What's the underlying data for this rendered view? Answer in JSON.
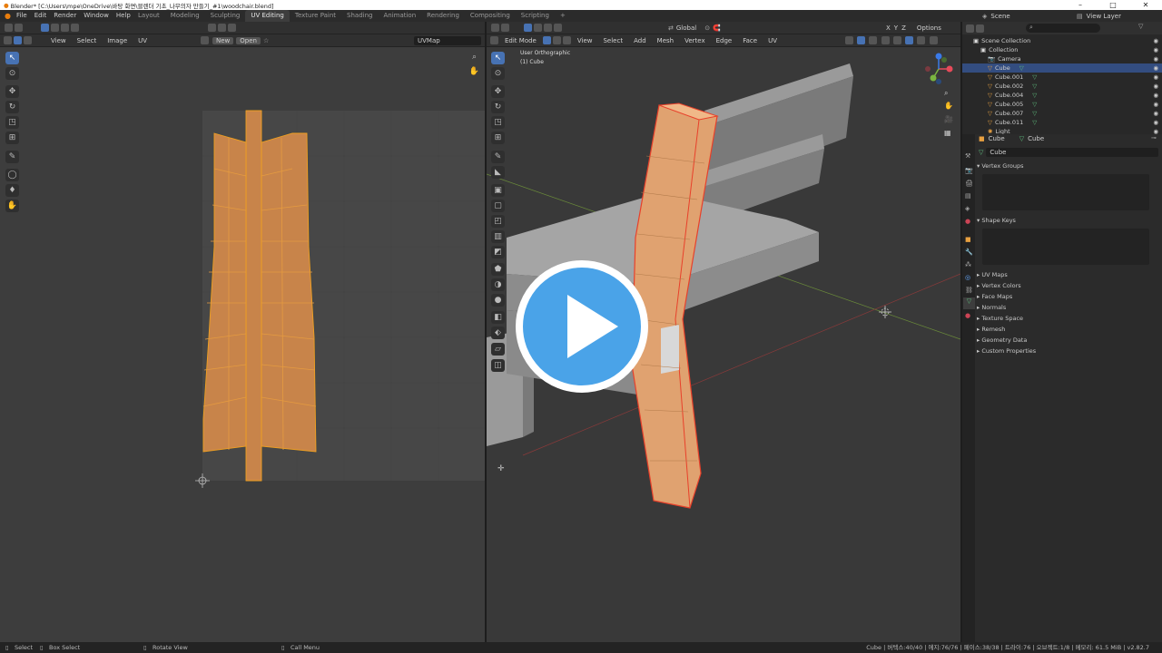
{
  "window": {
    "title": "Blender* [C:\\Users\\mpe\\OneDrive\\바탕 화면\\블렌더 기초_나무의자 만들기_#1\\woodchair.blend]",
    "controls": [
      "–",
      "□",
      "✕"
    ]
  },
  "topbar": {
    "menu": [
      "File",
      "Edit",
      "Render",
      "Window",
      "Help"
    ],
    "workspaces": [
      "Layout",
      "Modeling",
      "Sculpting",
      "UV Editing",
      "Texture Paint",
      "Shading",
      "Animation",
      "Rendering",
      "Compositing",
      "Scripting"
    ],
    "active_workspace": "UV Editing",
    "add_tab": "+",
    "scene_label": "Scene",
    "view_layer_label": "View Layer"
  },
  "uv_editor": {
    "menus": [
      "View",
      "Select",
      "Image",
      "UV"
    ],
    "new_label": "New",
    "open_label": "Open",
    "uvmap_value": "UVMap"
  },
  "viewport": {
    "mode_label": "Edit Mode",
    "menus": [
      "View",
      "Select",
      "Add",
      "Mesh",
      "Vertex",
      "Edge",
      "Face",
      "UV"
    ],
    "orientation": "Global",
    "axes": [
      "X",
      "Y",
      "Z"
    ],
    "options_label": "Options",
    "overlay_title": "User Orthographic",
    "overlay_subtitle": "(1) Cube",
    "gizmo_axes": [
      "X",
      "Y",
      "Z"
    ]
  },
  "outliner": {
    "search_placeholder": "",
    "items": [
      {
        "label": "Scene Collection",
        "indent": 0,
        "icon": "collection-icon"
      },
      {
        "label": "Collection",
        "indent": 1,
        "icon": "collection-icon"
      },
      {
        "label": "Camera",
        "indent": 2,
        "icon": "camera-icon"
      },
      {
        "label": "Cube",
        "indent": 2,
        "icon": "mesh-icon",
        "selected": true
      },
      {
        "label": "Cube.001",
        "indent": 2,
        "icon": "mesh-icon"
      },
      {
        "label": "Cube.002",
        "indent": 2,
        "icon": "mesh-icon"
      },
      {
        "label": "Cube.004",
        "indent": 2,
        "icon": "mesh-icon"
      },
      {
        "label": "Cube.005",
        "indent": 2,
        "icon": "mesh-icon"
      },
      {
        "label": "Cube.007",
        "indent": 2,
        "icon": "mesh-icon"
      },
      {
        "label": "Cube.011",
        "indent": 2,
        "icon": "mesh-icon"
      },
      {
        "label": "Light",
        "indent": 2,
        "icon": "light-icon"
      }
    ]
  },
  "properties": {
    "breadcrumb_object": "Cube",
    "breadcrumb_data": "Cube",
    "data_name": "Cube",
    "sections": [
      "Vertex Groups",
      "Shape Keys",
      "UV Maps",
      "Vertex Colors",
      "Face Maps",
      "Normals",
      "Texture Space",
      "Remesh",
      "Geometry Data",
      "Custom Properties"
    ]
  },
  "statusbar": {
    "left": [
      "Select",
      "Box Select",
      "Rotate View",
      "Call Menu"
    ],
    "right": "Cube | 버텍스:40/40 | 에지:76/76 | 페이스:38/38 | 트라이:76 | 오브젝트:1/8 | 메모리: 61.5 MiB | v2.82.7"
  },
  "colors": {
    "accent": "#4772b3",
    "uv_face": "#c8844a",
    "uv_edge": "#f0a020",
    "mesh_face": "#e0a270",
    "edit_edge": "#e8402a",
    "play_blue": "#4aa3e8"
  }
}
